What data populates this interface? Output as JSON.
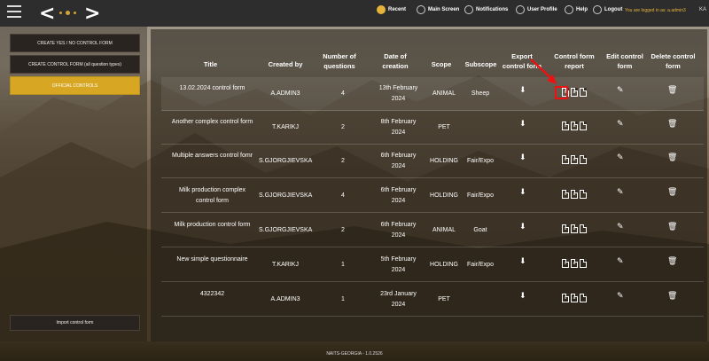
{
  "topbar": {
    "menu": [
      {
        "label": "Recent",
        "icon": "history-icon"
      },
      {
        "label": "Main Screen",
        "icon": "home-icon"
      },
      {
        "label": "Notifications",
        "icon": "bell-icon"
      },
      {
        "label": "User Profile",
        "icon": "user-icon"
      },
      {
        "label": "Help",
        "icon": "help-icon"
      },
      {
        "label": "Logout",
        "icon": "power-icon"
      }
    ],
    "logged_in": "You are logged in as: a.admin3",
    "user_initials": "KA"
  },
  "sidebar": {
    "buttons": [
      {
        "label": "CREATE YES / NO CONTROL FORM"
      },
      {
        "label": "CREATE CONTROL FORM (all question types)"
      },
      {
        "label": "OFFICIAL CONTROLS"
      }
    ],
    "import_label": "Import control form"
  },
  "table": {
    "headers": [
      "Title",
      "Created by",
      "Number of questions",
      "Date of creation",
      "Scope",
      "Subscope",
      "Export control form",
      "Control form report",
      "Edit control form",
      "Delete control form"
    ],
    "rows": [
      {
        "title": "13.02.2024 control form",
        "created_by": "A.ADMIN3",
        "questions": "4",
        "date": "13th February 2024",
        "scope": "ANIMAL",
        "subscope": "Sheep"
      },
      {
        "title": "Another complex control form",
        "created_by": "T.KARIKJ",
        "questions": "2",
        "date": "8th February 2024",
        "scope": "PET",
        "subscope": ""
      },
      {
        "title": "Multiple answers control fomr",
        "created_by": "S.GJORGJIEVSKA",
        "questions": "2",
        "date": "6th February 2024",
        "scope": "HOLDING",
        "subscope": "Fair/Expo"
      },
      {
        "title": "Milk production complex control form",
        "created_by": "S.GJORGJIEVSKA",
        "questions": "4",
        "date": "6th February 2024",
        "scope": "HOLDING",
        "subscope": "Fair/Expo"
      },
      {
        "title": "Milk production control form",
        "created_by": "S.GJORGJIEVSKA",
        "questions": "2",
        "date": "6th February 2024",
        "scope": "ANIMAL",
        "subscope": "Goat"
      },
      {
        "title": "New simple questionnaire",
        "created_by": "T.KARIKJ",
        "questions": "1",
        "date": "5th February 2024",
        "scope": "HOLDING",
        "subscope": "Fair/Expo"
      },
      {
        "title": "4322342",
        "created_by": "A.ADMIN3",
        "questions": "1",
        "date": "23rd January 2024",
        "scope": "PET",
        "subscope": ""
      }
    ]
  },
  "footer": {
    "version": "NAITS-GEORGIA - 1.0.2526"
  },
  "colors": {
    "accent": "#d7a724",
    "topbar": "#2d2d2d",
    "highlight": "#e11111"
  }
}
